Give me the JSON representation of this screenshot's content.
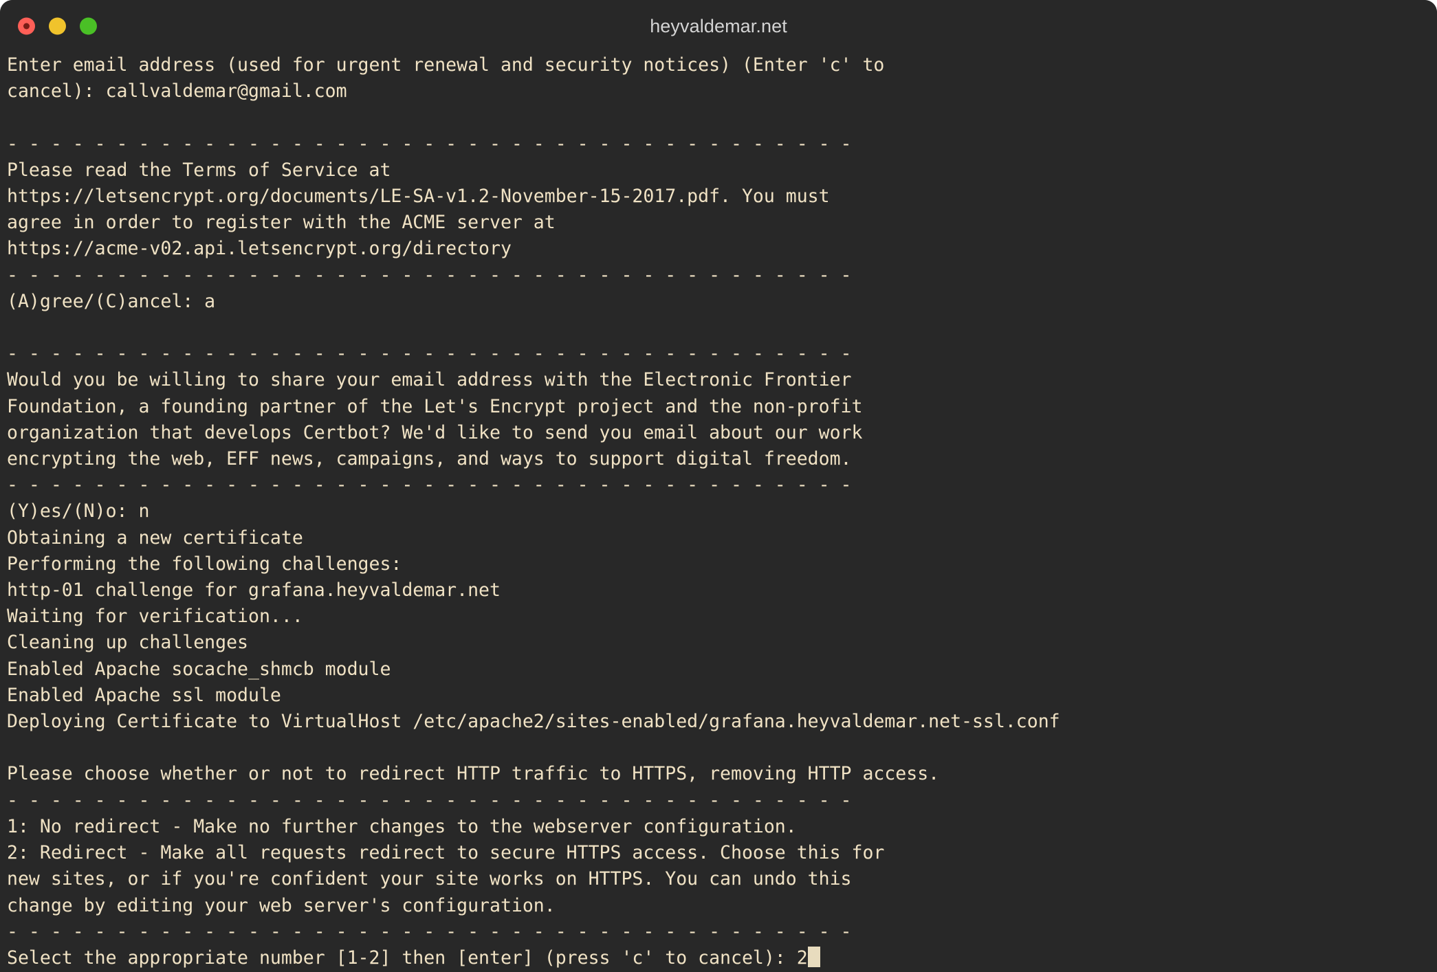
{
  "window": {
    "title": "heyvaldemar.net",
    "controls": [
      {
        "name": "close",
        "color": "#ff5f57"
      },
      {
        "name": "minimize",
        "color": "#f0c32c"
      },
      {
        "name": "maximize",
        "color": "#4ac026"
      }
    ],
    "background_color": "#282828",
    "text_color": "#f0e2c4"
  },
  "terminal": {
    "separator": "- - - - - - - - - - - - - - - - - - - - - - - - - - - - - - - - - - - - - - -",
    "cursor": {
      "shape": "block",
      "color": "#e8dcbe"
    },
    "lines": [
      "Enter email address (used for urgent renewal and security notices) (Enter 'c' to",
      "cancel): callvaldemar@gmail.com",
      "",
      "- - - - - - - - - - - - - - - - - - - - - - - - - - - - - - - - - - - - - - -",
      "Please read the Terms of Service at",
      "https://letsencrypt.org/documents/LE-SA-v1.2-November-15-2017.pdf. You must",
      "agree in order to register with the ACME server at",
      "https://acme-v02.api.letsencrypt.org/directory",
      "- - - - - - - - - - - - - - - - - - - - - - - - - - - - - - - - - - - - - - -",
      "(A)gree/(C)ancel: a",
      "",
      "- - - - - - - - - - - - - - - - - - - - - - - - - - - - - - - - - - - - - - -",
      "Would you be willing to share your email address with the Electronic Frontier",
      "Foundation, a founding partner of the Let's Encrypt project and the non-profit",
      "organization that develops Certbot? We'd like to send you email about our work",
      "encrypting the web, EFF news, campaigns, and ways to support digital freedom.",
      "- - - - - - - - - - - - - - - - - - - - - - - - - - - - - - - - - - - - - - -",
      "(Y)es/(N)o: n",
      "Obtaining a new certificate",
      "Performing the following challenges:",
      "http-01 challenge for grafana.heyvaldemar.net",
      "Waiting for verification...",
      "Cleaning up challenges",
      "Enabled Apache socache_shmcb module",
      "Enabled Apache ssl module",
      "Deploying Certificate to VirtualHost /etc/apache2/sites-enabled/grafana.heyvaldemar.net-ssl.conf",
      "",
      "Please choose whether or not to redirect HTTP traffic to HTTPS, removing HTTP access.",
      "- - - - - - - - - - - - - - - - - - - - - - - - - - - - - - - - - - - - - - -",
      "1: No redirect - Make no further changes to the webserver configuration.",
      "2: Redirect - Make all requests redirect to secure HTTPS access. Choose this for",
      "new sites, or if you're confident your site works on HTTPS. You can undo this",
      "change by editing your web server's configuration.",
      "- - - - - - - - - - - - - - - - - - - - - - - - - - - - - - - - - - - - - - -",
      "Select the appropriate number [1-2] then [enter] (press 'c' to cancel): 2"
    ],
    "prompt": {
      "text": "Select the appropriate number [1-2] then [enter] (press 'c' to cancel): ",
      "input_value": "2"
    }
  }
}
